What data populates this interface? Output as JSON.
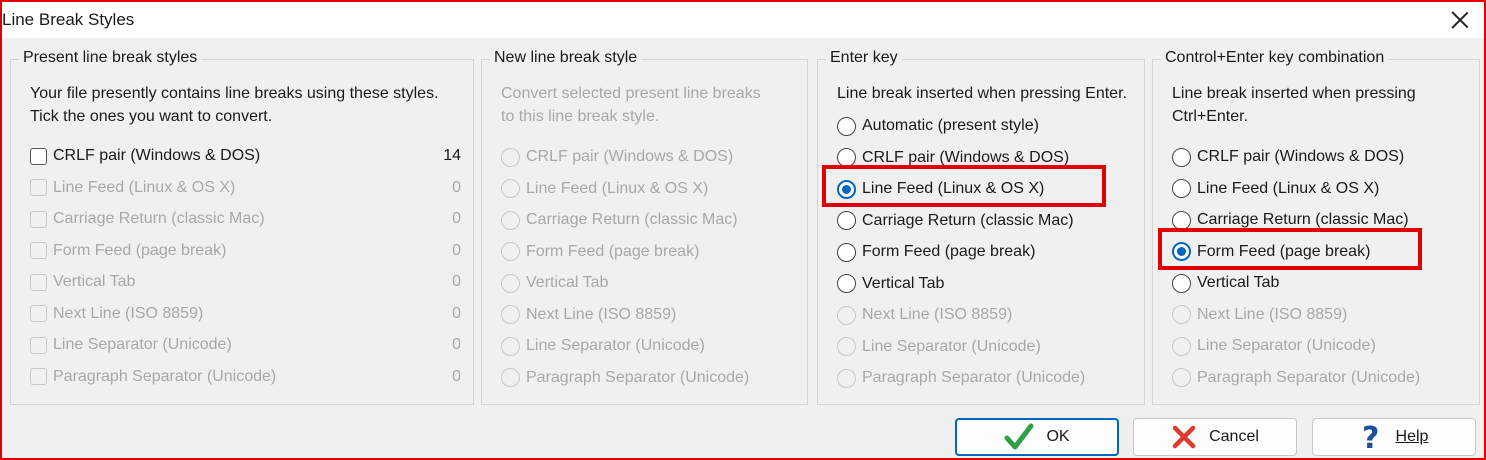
{
  "window": {
    "title": "Line Break Styles"
  },
  "present": {
    "legend": "Present line break styles",
    "desc": [
      "Your file presently contains line breaks using these styles.",
      "Tick the ones you want to convert."
    ],
    "items": [
      {
        "label": "CRLF pair (Windows & DOS)",
        "count": "14",
        "enabled": true,
        "checked": false
      },
      {
        "label": "Line Feed (Linux & OS X)",
        "count": "0",
        "enabled": false,
        "checked": false
      },
      {
        "label": "Carriage Return (classic Mac)",
        "count": "0",
        "enabled": false,
        "checked": false
      },
      {
        "label": "Form Feed (page break)",
        "count": "0",
        "enabled": false,
        "checked": false
      },
      {
        "label": "Vertical Tab",
        "count": "0",
        "enabled": false,
        "checked": false
      },
      {
        "label": "Next Line (ISO 8859)",
        "count": "0",
        "enabled": false,
        "checked": false
      },
      {
        "label": "Line Separator (Unicode)",
        "count": "0",
        "enabled": false,
        "checked": false
      },
      {
        "label": "Paragraph Separator (Unicode)",
        "count": "0",
        "enabled": false,
        "checked": false
      }
    ]
  },
  "new_style": {
    "legend": "New line break style",
    "desc": [
      "Convert selected present line breaks",
      "to this line break style."
    ],
    "items": [
      {
        "label": "CRLF pair (Windows & DOS)",
        "enabled": false,
        "selected": false
      },
      {
        "label": "Line Feed (Linux & OS X)",
        "enabled": false,
        "selected": false
      },
      {
        "label": "Carriage Return (classic Mac)",
        "enabled": false,
        "selected": false
      },
      {
        "label": "Form Feed (page break)",
        "enabled": false,
        "selected": false
      },
      {
        "label": "Vertical Tab",
        "enabled": false,
        "selected": false
      },
      {
        "label": "Next Line (ISO 8859)",
        "enabled": false,
        "selected": false
      },
      {
        "label": "Line Separator (Unicode)",
        "enabled": false,
        "selected": false
      },
      {
        "label": "Paragraph Separator (Unicode)",
        "enabled": false,
        "selected": false
      }
    ]
  },
  "enter_key": {
    "legend": "Enter key",
    "desc": [
      "Line break inserted when pressing Enter."
    ],
    "items": [
      {
        "label": "Automatic (present style)",
        "enabled": true,
        "selected": false
      },
      {
        "label": "CRLF pair (Windows & DOS)",
        "enabled": true,
        "selected": false
      },
      {
        "label": "Line Feed (Linux & OS X)",
        "enabled": true,
        "selected": true
      },
      {
        "label": "Carriage Return (classic Mac)",
        "enabled": true,
        "selected": false
      },
      {
        "label": "Form Feed (page break)",
        "enabled": true,
        "selected": false
      },
      {
        "label": "Vertical Tab",
        "enabled": true,
        "selected": false
      },
      {
        "label": "Next Line (ISO 8859)",
        "enabled": false,
        "selected": false
      },
      {
        "label": "Line Separator (Unicode)",
        "enabled": false,
        "selected": false
      },
      {
        "label": "Paragraph Separator (Unicode)",
        "enabled": false,
        "selected": false
      }
    ]
  },
  "ctrl_enter": {
    "legend": "Control+Enter key combination",
    "desc": [
      "Line break inserted when pressing",
      "Ctrl+Enter."
    ],
    "items": [
      {
        "label": "CRLF pair (Windows & DOS)",
        "enabled": true,
        "selected": false
      },
      {
        "label": "Line Feed (Linux & OS X)",
        "enabled": true,
        "selected": false
      },
      {
        "label": "Carriage Return (classic Mac)",
        "enabled": true,
        "selected": false
      },
      {
        "label": "Form Feed (page break)",
        "enabled": true,
        "selected": true
      },
      {
        "label": "Vertical Tab",
        "enabled": true,
        "selected": false
      },
      {
        "label": "Next Line (ISO 8859)",
        "enabled": false,
        "selected": false
      },
      {
        "label": "Line Separator (Unicode)",
        "enabled": false,
        "selected": false
      },
      {
        "label": "Paragraph Separator (Unicode)",
        "enabled": false,
        "selected": false
      }
    ]
  },
  "buttons": {
    "ok": "OK",
    "cancel": "Cancel",
    "help": "Help"
  },
  "icons": {
    "ok": "checkmark-icon",
    "cancel": "x-icon",
    "help": "question-mark-icon",
    "close": "close-icon"
  },
  "colors": {
    "accent": "#0067c0",
    "highlight": "#e00000",
    "ok_green": "#2ea043",
    "cancel_red": "#e03a2e"
  }
}
